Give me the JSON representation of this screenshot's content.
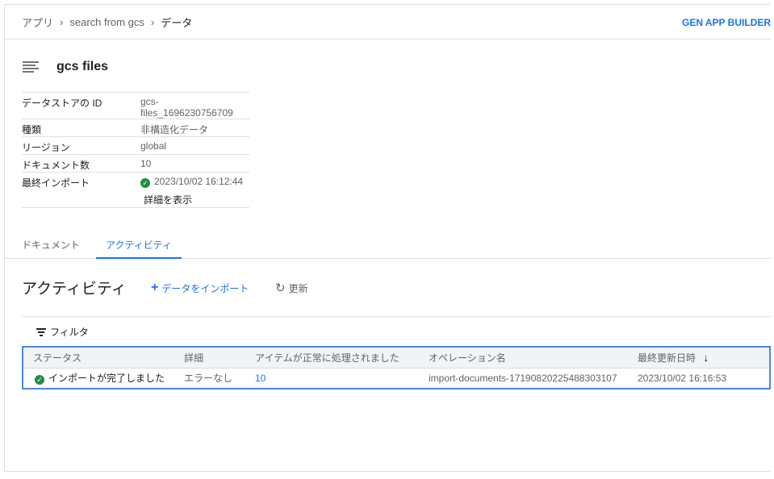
{
  "breadcrumb": [
    "アプリ",
    "search from gcs",
    "データ"
  ],
  "header_action": "GEN APP BUILDER",
  "title": "gcs files",
  "properties": [
    {
      "key": "データストアの ID",
      "value": "gcs-files_1696230756709"
    },
    {
      "key": "種類",
      "value": "非構造化データ"
    },
    {
      "key": "リージョン",
      "value": "global"
    },
    {
      "key": "ドキュメント数",
      "value": "10"
    },
    {
      "key": "最終インポート",
      "value": "2023/10/02 16:12:44",
      "link": "詳細を表示"
    }
  ],
  "tabs": [
    {
      "label": "ドキュメント"
    },
    {
      "label": "アクティビティ",
      "active": true
    }
  ],
  "activity": {
    "title": "アクティビティ",
    "import_label": "データをインポート",
    "refresh_label": "更新",
    "filter_label": "フィルタ"
  },
  "table": {
    "columns": [
      "ステータス",
      "詳細",
      "アイテムが正常に処理されました",
      "オペレーション名",
      "最終更新日時"
    ],
    "rows": [
      [
        "インポートが完了しました",
        "エラーなし",
        "10",
        "import-documents-17190820225488303107",
        "2023/10/02 16:16:53"
      ]
    ]
  },
  "colors": {
    "accent": "#1a73e8",
    "success": "#1e8e3e"
  }
}
